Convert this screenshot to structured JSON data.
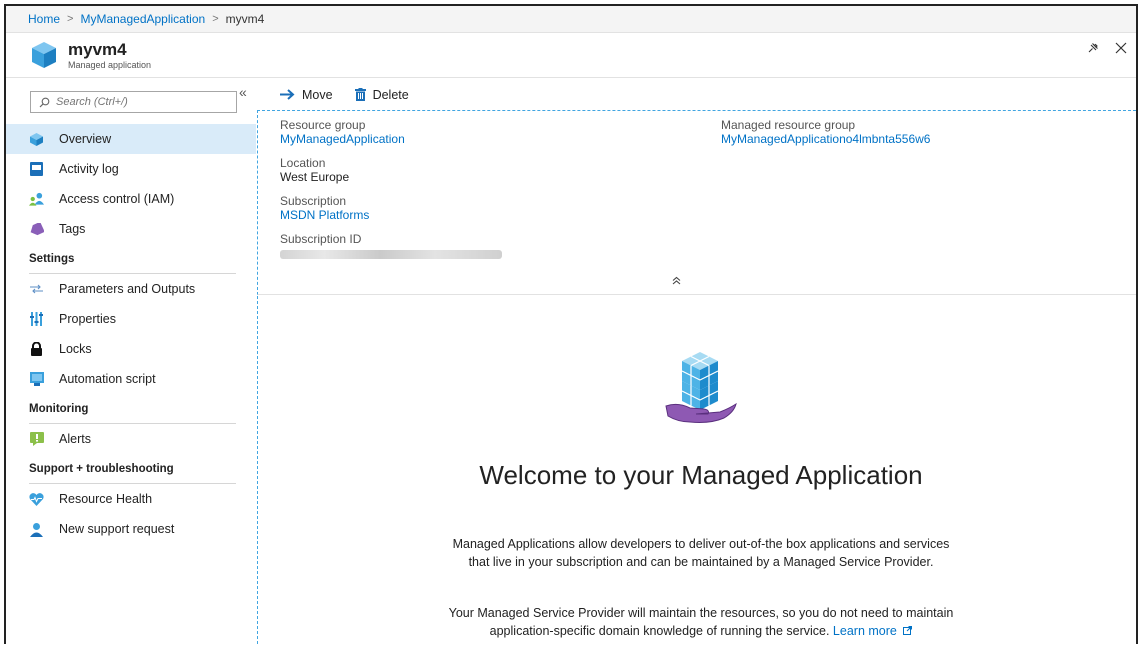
{
  "breadcrumb": {
    "home": "Home",
    "parent": "MyManagedApplication",
    "current": "myvm4"
  },
  "header": {
    "title": "myvm4",
    "subtitle": "Managed application"
  },
  "search": {
    "placeholder": "Search (Ctrl+/)"
  },
  "sidebar": {
    "collapse": "«",
    "items": [
      {
        "label": "Overview",
        "icon": "overview-icon"
      },
      {
        "label": "Activity log",
        "icon": "activity-log-icon"
      },
      {
        "label": "Access control (IAM)",
        "icon": "access-control-icon"
      },
      {
        "label": "Tags",
        "icon": "tag-icon"
      }
    ],
    "settings_header": "Settings",
    "settings_items": [
      {
        "label": "Parameters and Outputs",
        "icon": "parameters-icon"
      },
      {
        "label": "Properties",
        "icon": "properties-icon"
      },
      {
        "label": "Locks",
        "icon": "lock-icon"
      },
      {
        "label": "Automation script",
        "icon": "automation-script-icon"
      }
    ],
    "monitoring_header": "Monitoring",
    "monitoring_items": [
      {
        "label": "Alerts",
        "icon": "alert-icon"
      }
    ],
    "support_header": "Support + troubleshooting",
    "support_items": [
      {
        "label": "Resource Health",
        "icon": "resource-health-icon"
      },
      {
        "label": "New support request",
        "icon": "support-request-icon"
      }
    ]
  },
  "toolbar": {
    "move": "Move",
    "delete": "Delete"
  },
  "essentials": {
    "resource_group_label": "Resource group",
    "resource_group_value": "MyManagedApplication",
    "location_label": "Location",
    "location_value": "West Europe",
    "subscription_label": "Subscription",
    "subscription_value": "MSDN Platforms",
    "subscription_id_label": "Subscription ID",
    "managed_rg_label": "Managed resource group",
    "managed_rg_value": "MyManagedApplicationo4lmbnta556w6"
  },
  "welcome": {
    "title": "Welcome to your Managed Application",
    "p1_line1": "Managed Applications allow developers to deliver out-of-the box applications and services",
    "p1_line2": "that live in your subscription and can be maintained by a Managed Service Provider.",
    "p2_line1": "Your Managed Service Provider will maintain the resources, so you do not need to maintain",
    "p2_line2": "application-specific domain knowledge of running the service.",
    "learn_more": "Learn more"
  },
  "colors": {
    "link": "#0072c6",
    "active_nav": "#d9ebf9",
    "dashed_border": "#41a5e1"
  }
}
